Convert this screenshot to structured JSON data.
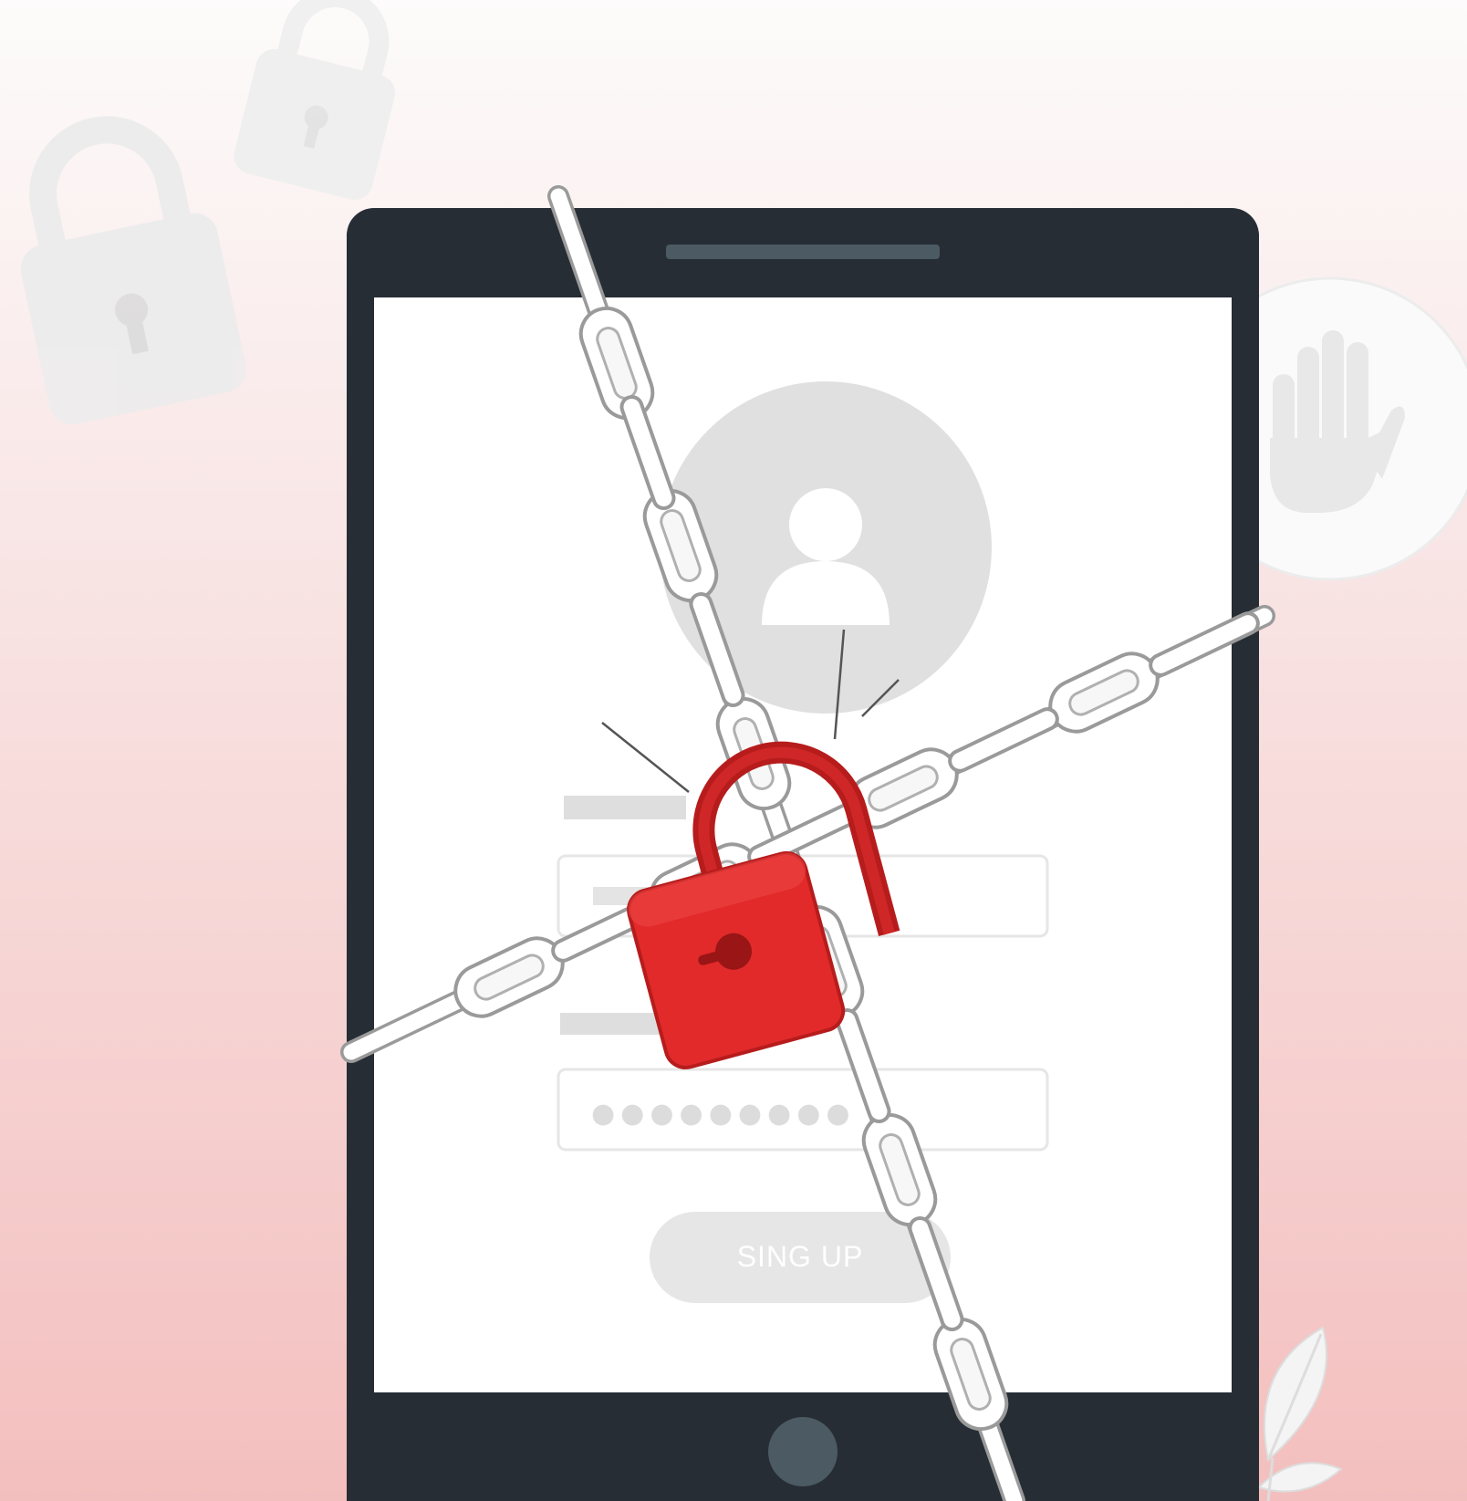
{
  "illustration": {
    "signup_button_label": "SING UP",
    "password_mask": "●●●●●●●●●",
    "colors": {
      "background_top": "#fdfbfb",
      "background_bottom": "#f3bfbe",
      "device_frame": "#262d34",
      "screen": "#ffffff",
      "speaker": "#4b5a63",
      "home_button": "#4b5a63",
      "avatar_circle": "#e0e0e0",
      "placeholder_gray": "#dedede",
      "chain_fill": "#ffffff",
      "chain_stroke": "#9a9a9a",
      "padlock_red": "#e22a2a",
      "padlock_shackle": "#b71c1c",
      "background_icon": "#ececec"
    },
    "icons": {
      "background_lock_large": "padlock-icon",
      "background_lock_small": "padlock-icon",
      "stop_hand": "stop-hand-icon",
      "user": "user-avatar-icon",
      "padlock": "padlock-icon",
      "leaf": "leaf-icon"
    }
  }
}
